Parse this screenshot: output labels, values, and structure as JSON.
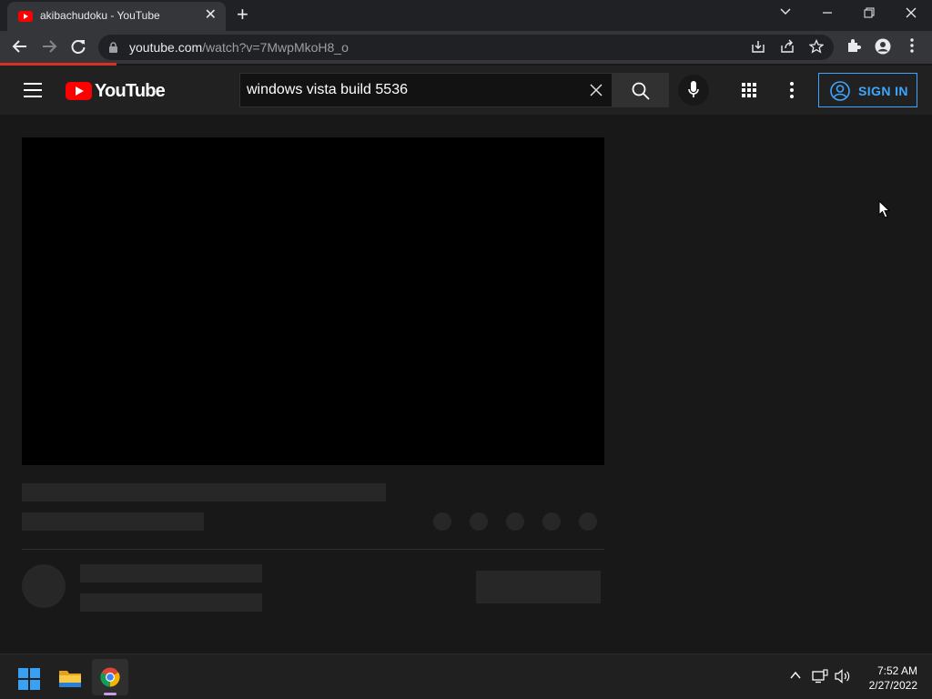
{
  "browser": {
    "tab": {
      "title": "akibachudoku - YouTube",
      "close_glyph": "✕"
    },
    "new_tab_glyph": "+",
    "window_controls": {
      "dropdown": "⌄",
      "minimize": "—",
      "restore": "❐",
      "close": "✕"
    },
    "url": {
      "host": "youtube.com",
      "path": "/watch?v=7MwpMkoH8_o"
    },
    "colors": {
      "tab_strip": "#202124",
      "toolbar": "#35363a",
      "loading_bar": "#d93025"
    }
  },
  "youtube": {
    "logo_text": "YouTube",
    "search": {
      "query": "windows vista build 5536",
      "clear_glyph": "✕"
    },
    "sign_in_label": "SIGN IN",
    "colors": {
      "brand_red": "#ff0000",
      "accent_blue": "#3ea6ff",
      "background": "#181818"
    }
  },
  "taskbar": {
    "clock": {
      "time": "7:52 AM",
      "date": "2/27/2022"
    },
    "pinned_apps": [
      "start-icon",
      "file-explorer-icon",
      "chrome-icon"
    ],
    "tray_icons": [
      "chevron-up-icon",
      "network-icon",
      "volume-icon"
    ]
  }
}
